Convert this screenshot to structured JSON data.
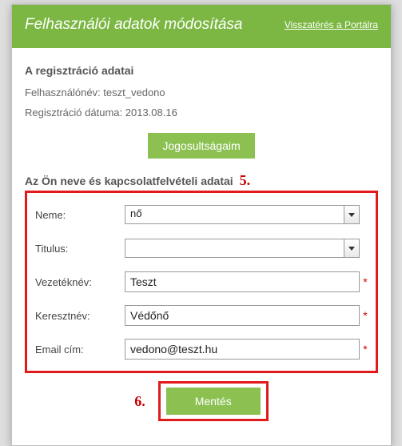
{
  "header": {
    "title": "Felhasználói adatok módosítása",
    "back": "Visszatérés a Portálra"
  },
  "reg": {
    "section": "A regisztráció adatai",
    "username_label": "Felhasználónév:",
    "username_value": "teszt_vedono",
    "regdate_label": "Regisztráció dátuma:",
    "regdate_value": "2013.08.16",
    "perms_button": "Jogosultságaim"
  },
  "contact": {
    "section": "Az Ön neve és kapcsolatfelvételi adatai",
    "fields": {
      "gender": {
        "label": "Neme:",
        "value": "nő"
      },
      "title": {
        "label": "Titulus:",
        "value": ""
      },
      "lastname": {
        "label": "Vezetéknév:",
        "value": "Teszt"
      },
      "firstname": {
        "label": "Keresztnév:",
        "value": "Védőnő"
      },
      "email": {
        "label": "Email cím:",
        "value": "vedono@teszt.hu"
      }
    }
  },
  "actions": {
    "save": "Mentés"
  },
  "annotations": {
    "five": "5.",
    "six": "6."
  }
}
